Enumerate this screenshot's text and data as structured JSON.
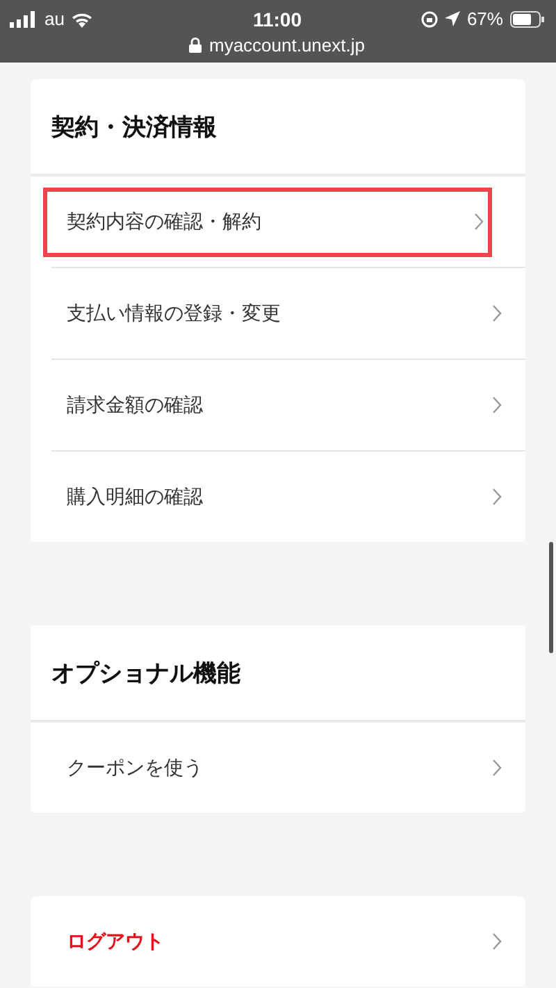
{
  "status_bar": {
    "carrier": "au",
    "time": "11:00",
    "battery": "67%",
    "url": "myaccount.unext.jp"
  },
  "sections": [
    {
      "title": "契約・決済情報",
      "items": [
        {
          "label": "契約内容の確認・解約",
          "kind": "normal",
          "highlighted": true
        },
        {
          "label": "支払い情報の登録・変更",
          "kind": "normal",
          "highlighted": false
        },
        {
          "label": "請求金額の確認",
          "kind": "normal",
          "highlighted": false
        },
        {
          "label": "購入明細の確認",
          "kind": "normal",
          "highlighted": false
        }
      ]
    },
    {
      "title": "オプショナル機能",
      "items": [
        {
          "label": "クーポンを使う",
          "kind": "normal",
          "highlighted": false
        }
      ]
    },
    {
      "items": [
        {
          "label": "ログアウト",
          "kind": "danger",
          "highlighted": false
        }
      ]
    }
  ]
}
